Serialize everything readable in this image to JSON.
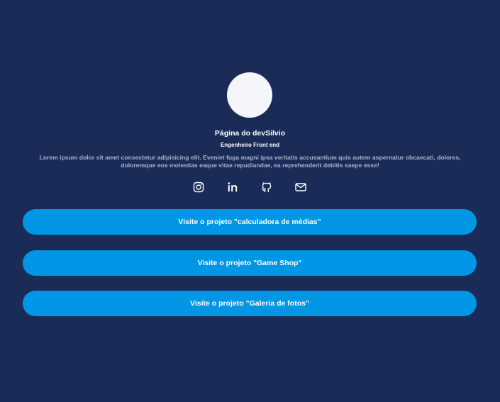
{
  "profile": {
    "name": "Página do devSilvio",
    "role": "Engenheiro Front end",
    "bio": "Lorem ipsum dolor sit amet consectetur adipisicing elit. Eveniet fuga magni ipsa veritatis accusantium quis autem aspernatur obcaecati, dolores, doloremque eos molestias eaque vitae repudiandae, ea reprehenderit debitis saepe esse!"
  },
  "socials": [
    {
      "icon": "instagram-icon"
    },
    {
      "icon": "linkedin-icon"
    },
    {
      "icon": "github-icon"
    },
    {
      "icon": "mail-icon"
    }
  ],
  "links": [
    {
      "label": "Visite o projeto \"calculadora de médias\""
    },
    {
      "label": "Visite o projeto \"Game Shop\""
    },
    {
      "label": "Visite o projeto \"Galeria de fotos\""
    }
  ],
  "colors": {
    "background": "#1b2b58",
    "button": "#0096e6",
    "avatar": "#f5f6fb",
    "bio_text": "#aab3cc"
  }
}
